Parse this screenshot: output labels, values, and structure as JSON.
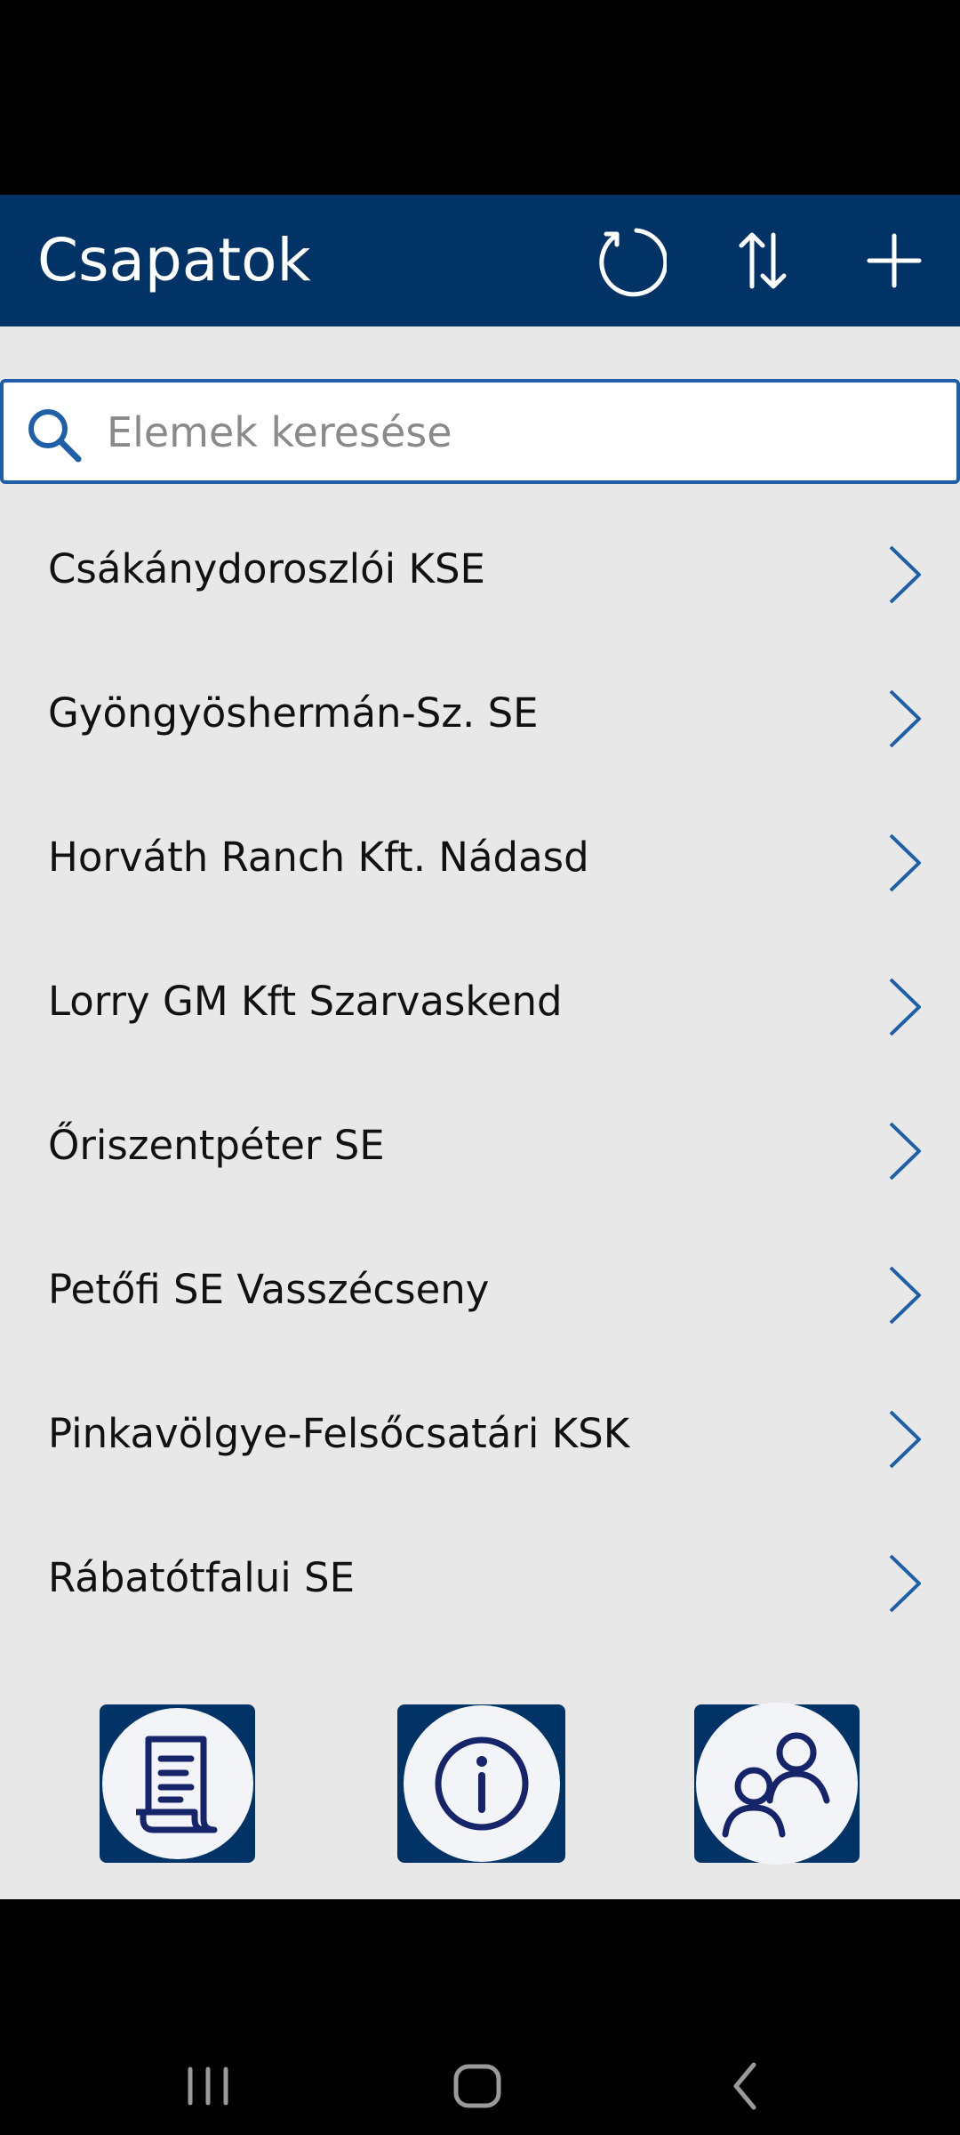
{
  "header": {
    "title": "Csapatok"
  },
  "search": {
    "placeholder": "Elemek keresése",
    "value": ""
  },
  "teams": [
    "Csákánydoroszlói KSE",
    "Gyöngyöshermán-Sz. SE",
    "Horváth Ranch Kft. Nádasd",
    "Lorry GM Kft Szarvaskend",
    "Őriszentpéter SE",
    "Petőfi SE Vasszécseny",
    "Pinkavölgye-Felsőcsatári KSK",
    "Rábatótfalui SE"
  ],
  "icons": {
    "refresh": "refresh-icon",
    "sort": "sort-icon",
    "add": "add-icon",
    "search": "search-icon",
    "chevron": "chevron-right-icon",
    "document": "document-icon",
    "info": "info-icon",
    "people": "people-icon"
  },
  "colors": {
    "header": "#023366",
    "background": "#e8e8e8",
    "accent": "#1f5fa8",
    "tile": "#023366"
  }
}
